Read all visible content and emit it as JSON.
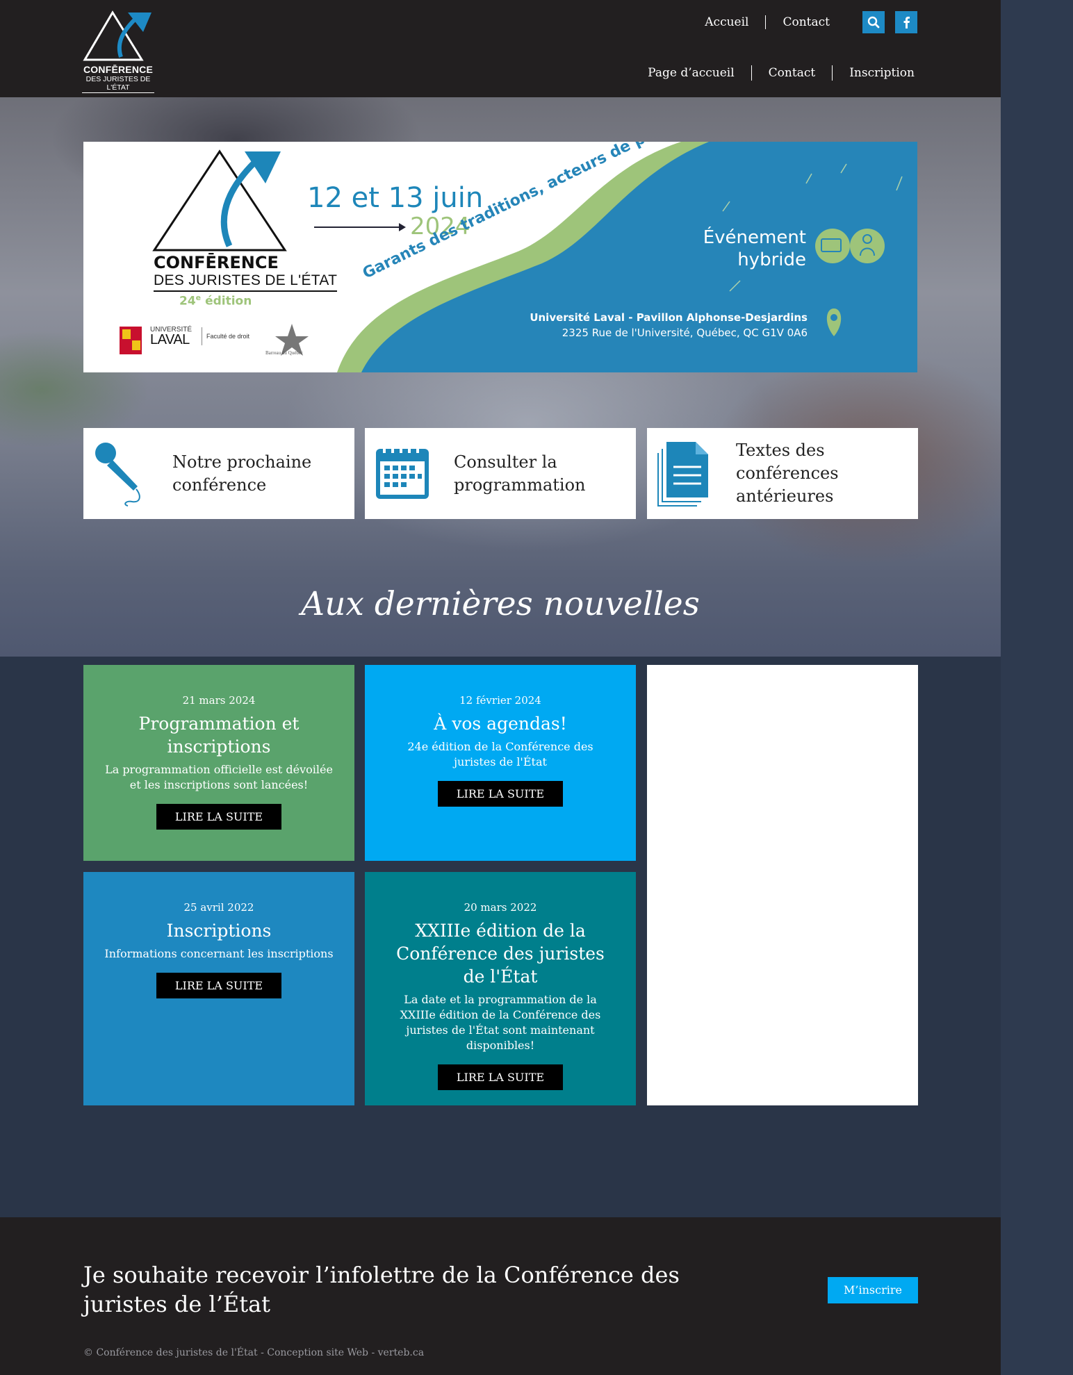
{
  "header": {
    "logo_line1": "CONFĒRENCE",
    "logo_line2": "DES JURISTES DE L'ÉTAT",
    "topnav": [
      "Accueil",
      "Contact"
    ],
    "mainnav": [
      "Page d’accueil",
      "Contact",
      "Inscription"
    ],
    "search_icon": "search-icon",
    "facebook_icon": "facebook-icon",
    "accent": "#1d8ac5"
  },
  "banner": {
    "dates_line1": "12 et 13 juin",
    "dates_line2": "2024",
    "conf_line1": "CONFĒRENCE",
    "conf_line2": "DES JURISTES DE L'ÉTAT",
    "edition_number": "24",
    "edition_sup": "e",
    "edition_word": "édition",
    "slogan": "Garants des traditions, acteurs de progrès",
    "event_line1": "Événement",
    "event_line2": "hybride",
    "address_line1": "Université Laval - Pavillon Alphonse-Desjardins",
    "address_line2": "2325 Rue de l'Université, Québec, QC G1V 0A6",
    "laval_small": "UNIVERSITÉ",
    "laval_big": "LAVAL",
    "faculty": "Faculté de droit",
    "barreau": "Barreau du Québec",
    "colors": {
      "blue": "#2685b8",
      "green": "#9ec47a"
    }
  },
  "features": [
    {
      "label": "Notre prochaine conférence",
      "icon": "microphone-icon"
    },
    {
      "label": "Consulter la programmation",
      "icon": "calendar-icon"
    },
    {
      "label": "Textes des conférences antérieures",
      "icon": "document-icon"
    }
  ],
  "news_section_title": "Aux dernières nouvelles",
  "news": [
    {
      "date": "21 mars 2024",
      "title": "Programmation et inscriptions",
      "desc": "La programmation officielle est dévoilée et les inscriptions sont lancées!",
      "button": "LIRE LA SUITE",
      "color": "#5aa36c"
    },
    {
      "date": "12 février 2024",
      "title": "À vos agendas!",
      "desc": "24e édition de la Conférence des juristes de l'État",
      "button": "LIRE LA SUITE",
      "color": "#00a9f2"
    },
    {
      "date": "25 avril 2022",
      "title": "Inscriptions",
      "desc": "Informations concernant les inscriptions",
      "button": "LIRE LA SUITE",
      "color": "#1e88c0"
    },
    {
      "date": "20 mars 2022",
      "title": "XXIIIe édition de la Conférence des juristes de l'État",
      "desc": "La date et la programmation de la XXIIIe édition de la Conférence des juristes de l'État sont maintenant disponibles!",
      "button": "LIRE LA SUITE",
      "color": "#007f8c"
    }
  ],
  "footer": {
    "newsletter_text": "Je souhaite recevoir l’infolettre de la Conférence des juristes de l’État",
    "newsletter_button": "M’inscrire",
    "copyright": "© Conférence des juristes de l'État  -  Conception site Web - verteb.ca"
  }
}
